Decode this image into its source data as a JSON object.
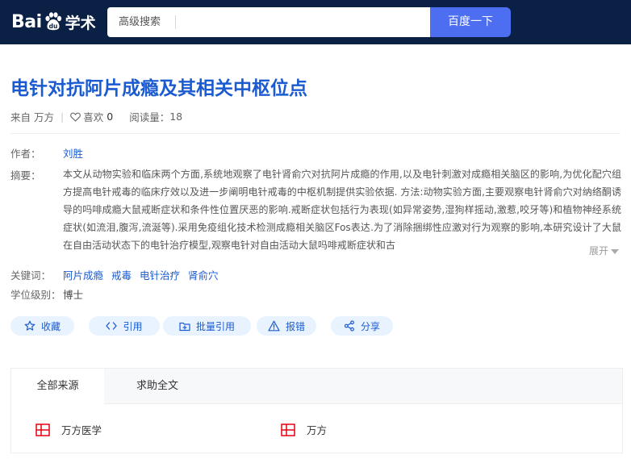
{
  "header": {
    "logo_bai": "Bai",
    "logo_du": "du",
    "logo_xueshu": "学术",
    "search_adv_label": "高级搜索",
    "search_value": "",
    "search_button": "百度一下"
  },
  "paper": {
    "title": "电针对抗阿片成瘾及其相关中枢位点",
    "source_label": "来自",
    "source_name": "万方",
    "like_label": "喜欢",
    "like_count": "0",
    "reads_label": "阅读量：",
    "reads_count": "18"
  },
  "details": {
    "author_label": "作者：",
    "author": "刘胜",
    "abstract_label": "摘要：",
    "abstract": "本文从动物实验和临床两个方面,系统地观察了电针肾俞穴对抗阿片成瘾的作用,以及电针刺激对成瘾相关脑区的影响,为优化配穴组方提高电针戒毒的临床疗效以及进一步阐明电针戒毒的中枢机制提供实验依据. 方法:动物实验方面,主要观察电针肾俞穴对纳络酮诱导的吗啡成瘾大鼠戒断症状和条件性位置厌恶的影响.戒断症状包括行为表现(如异常姿势,湿狗样摇动,激惹,咬牙等)和植物神经系统症状(如流泪,腹泻,流涎等).采用免疫组化技术检测成瘾相关脑区Fos表达.为了消除捆绑性应激对行为观察的影响,本研究设计了大鼠在自由活动状态下的电针治疗模型,观察电针对自由活动大鼠吗啡戒断症状和古",
    "expand_label": "展开",
    "keywords_label": "关键词：",
    "keywords": [
      "阿片成瘾",
      "戒毒",
      "电针治疗",
      "肾俞穴"
    ],
    "degree_label": "学位级别：",
    "degree": "博士"
  },
  "actions": {
    "collect": "收藏",
    "cite": "引用",
    "batch_cite": "批量引用",
    "report": "报错",
    "share": "分享"
  },
  "sources": {
    "tabs": [
      "全部来源",
      "求助全文"
    ],
    "items": [
      "万方医学",
      "万方"
    ]
  },
  "colors": {
    "header_bg": "#0a2145",
    "accent": "#1b5bd1",
    "search_button": "#4e6ef2",
    "action_bg": "#e8f3ff",
    "source_icon": "#e60012"
  }
}
